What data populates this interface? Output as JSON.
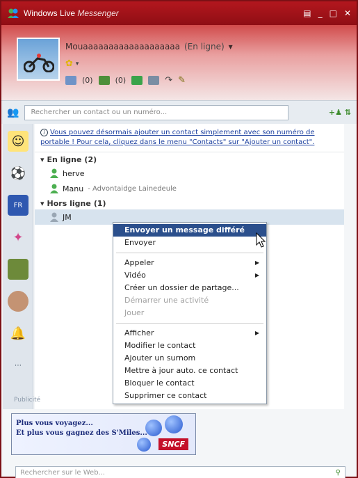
{
  "window": {
    "app_name": "Windows Live",
    "app_sub": "Messenger"
  },
  "profile": {
    "name": "Mouaaaaaaaaaaaaaaaaaaa",
    "status": "(En ligne)",
    "toolbar": {
      "mail_count": "(0)",
      "contacts_count": "(0)"
    }
  },
  "search": {
    "placeholder": "Rechercher un contact ou un numéro..."
  },
  "info_text": "Vous pouvez désormais ajouter un contact simplement avec son numéro de portable ! Pour cela, cliquez dans le menu \"Contacts\" sur \"Ajouter un contact\".",
  "groups": [
    {
      "label": "En ligne",
      "count": "(2)",
      "contacts": [
        {
          "name": "herve",
          "message": ""
        },
        {
          "name": "Manu",
          "message": "Advontaidge Lainedeule"
        }
      ]
    },
    {
      "label": "Hors ligne",
      "count": "(1)",
      "contacts": [
        {
          "name": "JM",
          "message": ""
        }
      ]
    }
  ],
  "context_menu": {
    "send_deferred": "Envoyer un message différé",
    "send": "Envoyer",
    "call": "Appeler",
    "video": "Vidéo",
    "create_share": "Créer un dossier de partage...",
    "start_activity": "Démarrer une activité",
    "play": "Jouer",
    "show": "Afficher",
    "edit_contact": "Modifier le contact",
    "add_nickname": "Ajouter un surnom",
    "auto_update": "Mettre à jour auto. ce contact",
    "block": "Bloquer le contact",
    "delete": "Supprimer ce contact"
  },
  "ad": {
    "label": "Publicité",
    "line1": "Plus vous voyagez...",
    "line2": "Et plus vous gagnez des S'Miles... Et",
    "brand": "SNCF"
  },
  "web_search": {
    "placeholder": "Rechercher sur le Web..."
  },
  "colors": {
    "titlebar": "#a3131a",
    "menu_highlight": "#2b4f8c",
    "link": "#1b3f9f"
  }
}
